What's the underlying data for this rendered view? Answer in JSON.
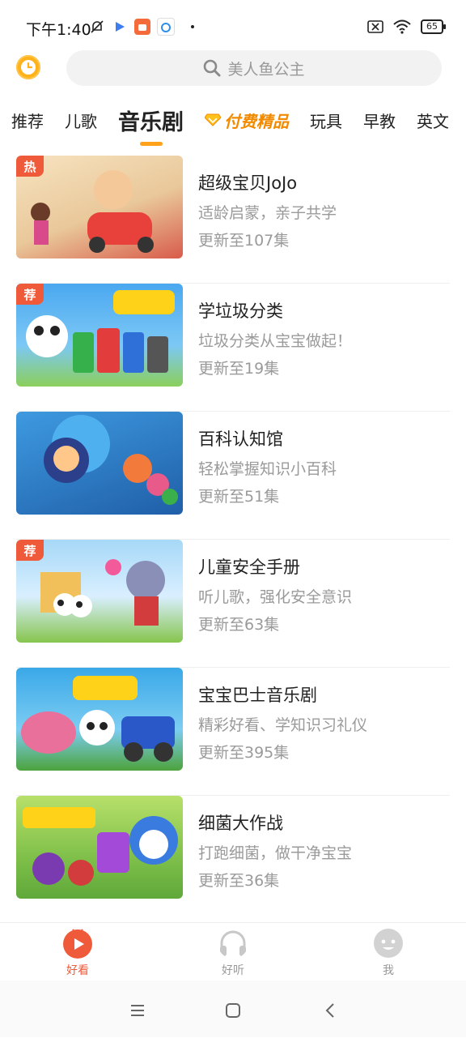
{
  "status_bar": {
    "time": "下午1:40",
    "battery": "65"
  },
  "search": {
    "placeholder": "美人鱼公主"
  },
  "tabs": [
    {
      "label": "推荐"
    },
    {
      "label": "儿歌"
    },
    {
      "label": "音乐剧",
      "active": true
    },
    {
      "label": "付费精品"
    },
    {
      "label": "玩具"
    },
    {
      "label": "早教"
    },
    {
      "label": "英文"
    }
  ],
  "items": [
    {
      "title": "超级宝贝JoJo",
      "desc": "适龄启蒙，亲子共学",
      "count": "更新至107集",
      "badge": "热",
      "thumb_color": "#f3d9a8"
    },
    {
      "title": "学垃圾分类",
      "desc": "垃圾分类从宝宝做起！",
      "count": "更新至19集",
      "badge": "荐",
      "thumb_color": "#5fb0f0"
    },
    {
      "title": "百科认知馆",
      "desc": "轻松掌握知识小百科",
      "count": "更新至51集",
      "badge": "",
      "thumb_color": "#2a78c8"
    },
    {
      "title": "儿童安全手册",
      "desc": "听儿歌，强化安全意识",
      "count": "更新至63集",
      "badge": "荐",
      "thumb_color": "#9ad0f5"
    },
    {
      "title": "宝宝巴士音乐剧",
      "desc": "精彩好看、学知识习礼仪",
      "count": "更新至395集",
      "badge": "",
      "thumb_color": "#4bb3e6"
    },
    {
      "title": "细菌大作战",
      "desc": "打跑细菌，做干净宝宝",
      "count": "更新至36集",
      "badge": "",
      "thumb_color": "#7fc04a"
    }
  ],
  "bottom_nav": [
    {
      "label": "好看",
      "active": true
    },
    {
      "label": "好听"
    },
    {
      "label": "我"
    }
  ],
  "colors": {
    "accent": "#ffa21a",
    "badge": "#ef5a3b",
    "premium": "#f28a00"
  }
}
